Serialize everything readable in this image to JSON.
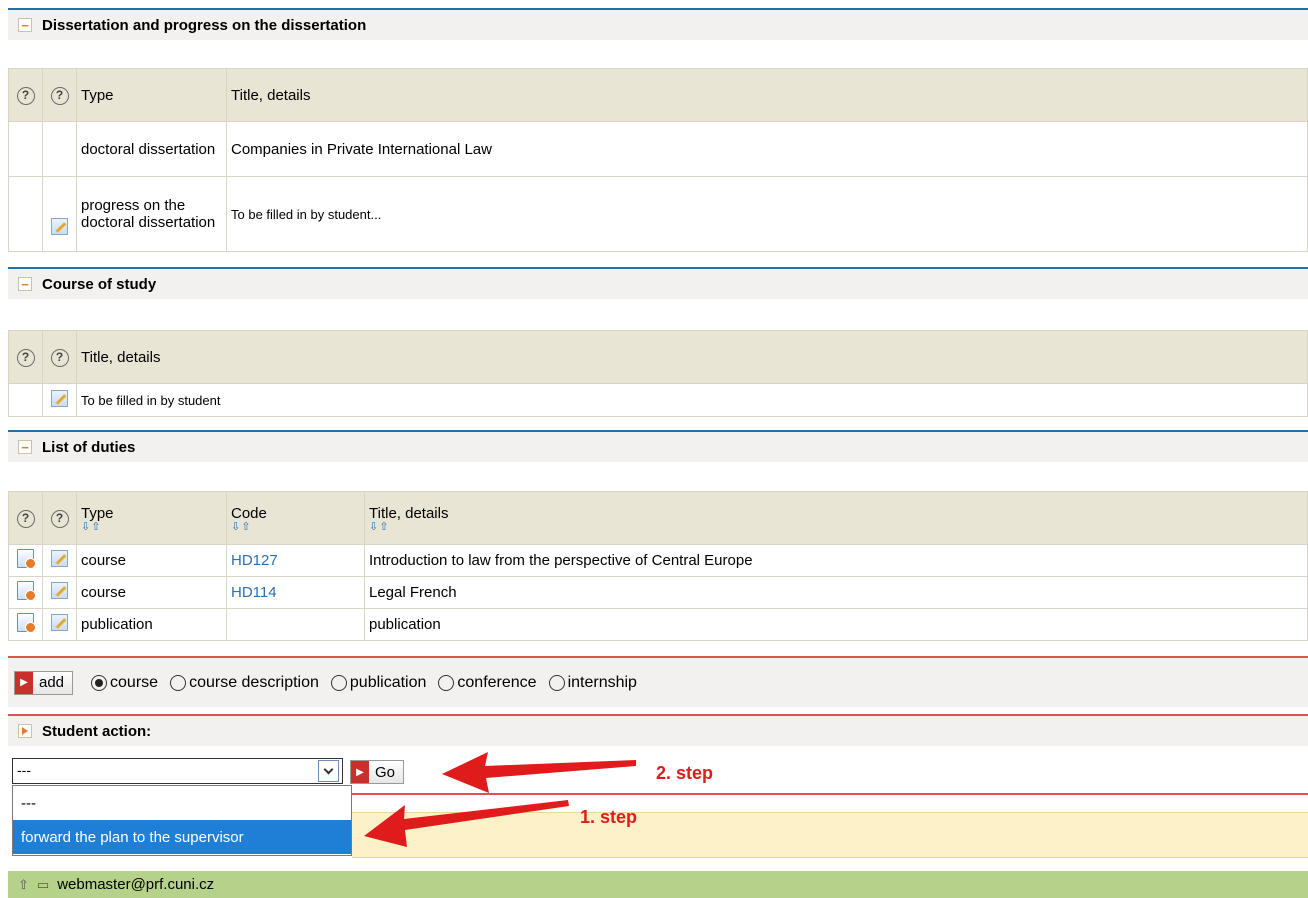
{
  "diss": {
    "title": "Dissertation and progress on the dissertation",
    "columns": [
      "Type",
      "Title, details"
    ],
    "rows": [
      {
        "type": "doctoral dissertation",
        "details": "Companies in Private International Law"
      },
      {
        "type": "progress on the doctoral dissertation",
        "details": "To be filled in by student..."
      }
    ]
  },
  "course": {
    "title": "Course of study",
    "column": "Title, details",
    "row": "To be filled in by student"
  },
  "duties": {
    "title": "List of duties",
    "columns": [
      "Type",
      "Code",
      "Title, details"
    ],
    "sort_glyph": "⇩⇧",
    "rows": [
      {
        "type": "course",
        "code": "HD127",
        "details": "Introduction to law from the perspective of Central Europe"
      },
      {
        "type": "course",
        "code": "HD114",
        "details": "Legal French"
      },
      {
        "type": "publication",
        "code": "",
        "details": "publication"
      }
    ]
  },
  "add_bar": {
    "button_label": "add",
    "options": [
      "course",
      "course description",
      "publication",
      "conference",
      "internship"
    ],
    "selected": "course"
  },
  "student_action": {
    "title": "Student action:",
    "select_value": "---",
    "go_label": "Go",
    "dropdown_options": [
      "---",
      "forward the plan to the supervisor"
    ],
    "dropdown_highlight": "forward the plan to the supervisor"
  },
  "annotations": {
    "step1": "1. step",
    "step2": "2. step"
  },
  "footer": {
    "email": "webmaster@prf.cuni.cz"
  },
  "colors": {
    "section_line": "#1f6fa8",
    "red_line": "#d9534f",
    "header_bg": "#e9e5d5",
    "footer_bg": "#b5d18a",
    "highlight": "#1f7fd6",
    "annotation": "#e01b1b"
  },
  "icons": [
    "help-icon",
    "edit-icon",
    "document-icon",
    "collapse-icon",
    "expand-icon",
    "chevron-down-icon",
    "up-arrow-icon",
    "lock-icon",
    "arrow-annotation"
  ]
}
